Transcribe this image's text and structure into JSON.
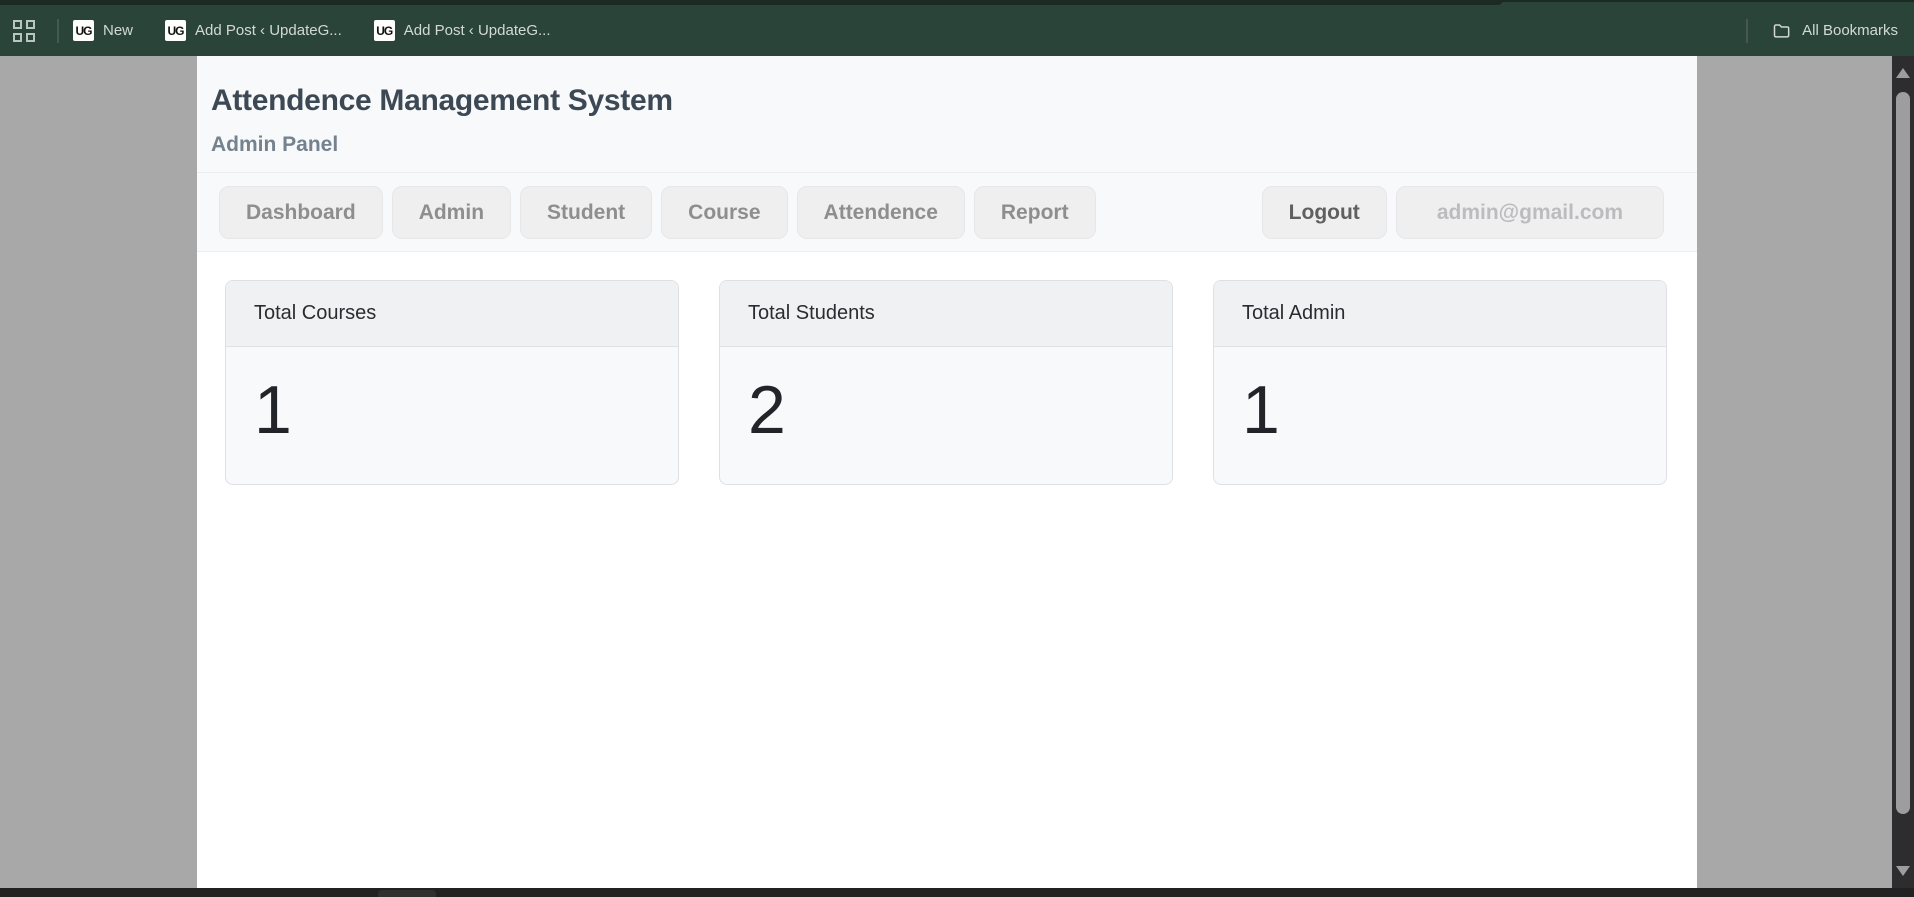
{
  "browser": {
    "bookmarks": [
      {
        "favicon": "UG",
        "label": "New"
      },
      {
        "favicon": "UG",
        "label": "Add Post ‹ UpdateG..."
      },
      {
        "favicon": "UG",
        "label": "Add Post ‹ UpdateG..."
      }
    ],
    "all_bookmarks_label": "All Bookmarks"
  },
  "page": {
    "title": "Attendence Management System",
    "subtitle": "Admin Panel",
    "nav": {
      "items": [
        "Dashboard",
        "Admin",
        "Student",
        "Course",
        "Attendence",
        "Report"
      ],
      "logout_label": "Logout",
      "user_email": "admin@gmail.com"
    },
    "cards": [
      {
        "title": "Total Courses",
        "value": "1"
      },
      {
        "title": "Total Students",
        "value": "2"
      },
      {
        "title": "Total Admin",
        "value": "1"
      }
    ]
  },
  "colors": {
    "bookmarks_bar": "#2a443a",
    "tab_remnant": "#1b2a23",
    "desktop_gray": "#a8a8a8",
    "title_text": "#3d4855",
    "subtitle_text": "#74828f",
    "card_header_bg": "#f0f1f2",
    "card_body_bg": "#f8f9fa"
  }
}
